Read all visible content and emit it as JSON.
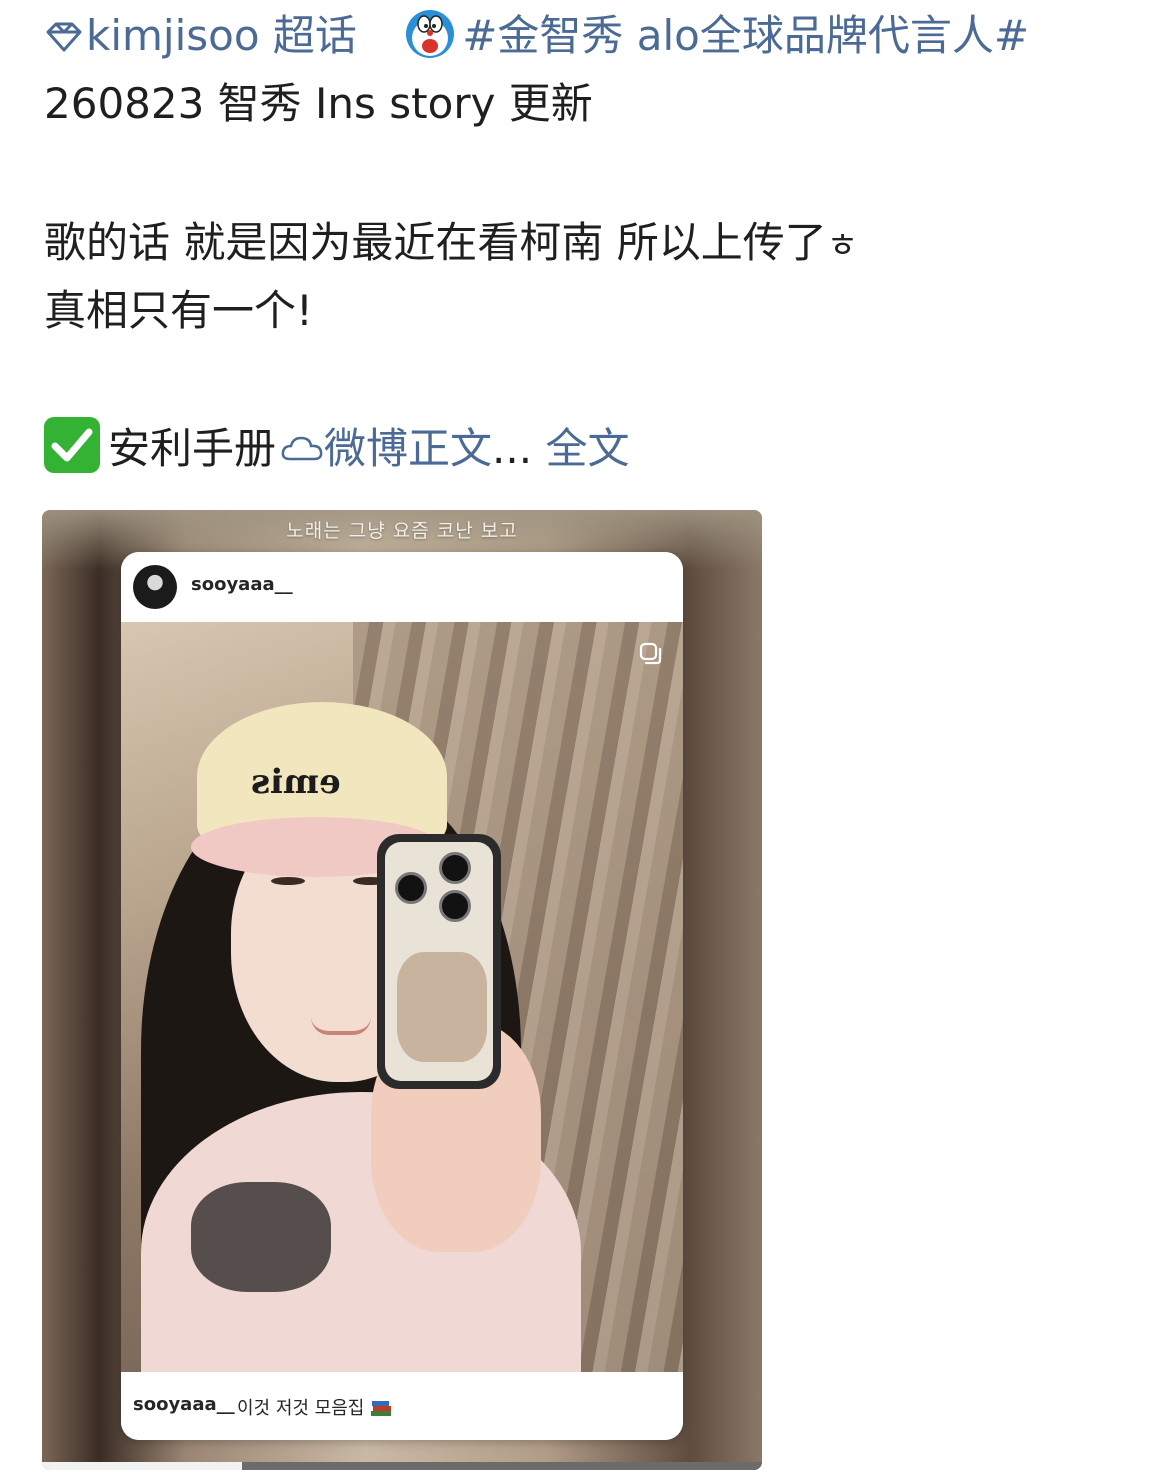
{
  "post": {
    "topic": "kimjisoo 超话",
    "hashtag": "#金智秀 alo全球品牌代言人#",
    "line2": "260823 智秀 Ins story 更新",
    "line3": "歌的话 就是因为最近在看柯南 所以上传了",
    "line3_hangul": "ㅎ",
    "line4": "真相只有一个!",
    "line5_label": "安利手册",
    "line5_link": "微博正文",
    "ellipsis": "...",
    "full_text_link": "全文"
  },
  "icons": {
    "topic": "diamond-outline-icon",
    "hashtag_prefix": "doraemon-emoji-icon",
    "checkmark": "check-mark-button-icon",
    "weibo_link": "cloud-link-icon",
    "photo_multi": "copy-square-icon",
    "book": "books-emoji-icon"
  },
  "story": {
    "top_caption": "노래는 그냥 요즘 코난 보고",
    "username": "sooyaaa__",
    "cap_text": "emis",
    "footer_user": "sooyaaa__",
    "footer_caption": "이것 저것 모음집"
  },
  "colors": {
    "link": "#4b6a95",
    "check_bg": "#34b233"
  }
}
